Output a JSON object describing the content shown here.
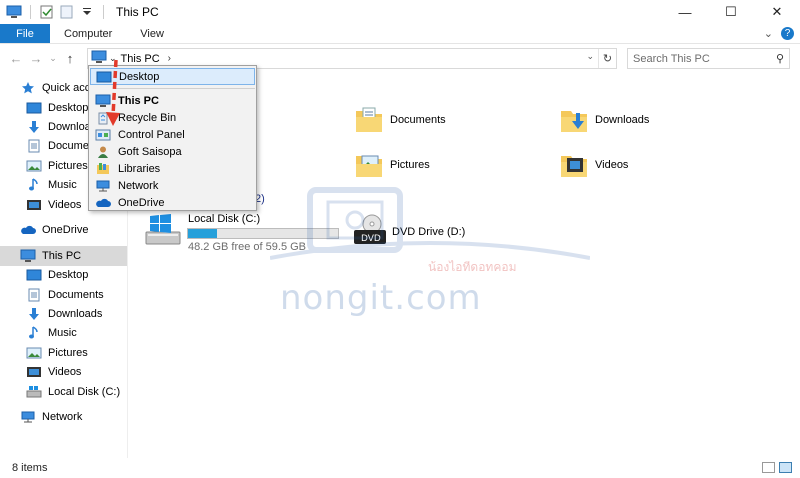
{
  "window": {
    "title": "This PC",
    "minimize": "—",
    "maximize": "☐",
    "close": "✕"
  },
  "ribbon": {
    "file": "File",
    "tabs": [
      "Computer",
      "View"
    ],
    "expand": "⌄",
    "help": "?"
  },
  "nav": {
    "back": "←",
    "forward": "→",
    "recent": "⌄",
    "up": "↑",
    "address_chevron": "⌄",
    "crumb": "This PC",
    "crumb_arrow": "›",
    "address_dropdown": "⌄",
    "refresh": "↻",
    "search_placeholder": "Search This PC",
    "search_icon": "⚲"
  },
  "sidebar": {
    "items": [
      {
        "label": "Quick access",
        "icon": "star-icon"
      },
      {
        "label": "Desktop",
        "icon": "desktop-icon"
      },
      {
        "label": "Downloads",
        "icon": "download-icon"
      },
      {
        "label": "Documents",
        "icon": "documents-icon"
      },
      {
        "label": "Pictures",
        "icon": "pictures-icon"
      },
      {
        "label": "Music",
        "icon": "music-icon"
      },
      {
        "label": "Videos",
        "icon": "videos-icon"
      },
      {
        "label": "OneDrive",
        "icon": "onedrive-icon"
      },
      {
        "label": "This PC",
        "icon": "computer-icon"
      },
      {
        "label": "Desktop",
        "icon": "desktop-icon"
      },
      {
        "label": "Documents",
        "icon": "documents-icon"
      },
      {
        "label": "Downloads",
        "icon": "download-icon"
      },
      {
        "label": "Music",
        "icon": "music-icon"
      },
      {
        "label": "Pictures",
        "icon": "pictures-icon"
      },
      {
        "label": "Videos",
        "icon": "videos-icon"
      },
      {
        "label": "Local Disk (C:)",
        "icon": "drive-icon"
      },
      {
        "label": "Network",
        "icon": "network-icon"
      }
    ]
  },
  "content": {
    "folders": [
      {
        "label": "Documents"
      },
      {
        "label": "Downloads"
      },
      {
        "label": "Pictures"
      },
      {
        "label": "Videos"
      }
    ],
    "devices_header_tail": "2)",
    "drives": [
      {
        "label": "Local Disk (C:)",
        "free": "48.2 GB free of 59.5 GB",
        "used_fraction": 0.19
      },
      {
        "label": "DVD Drive (D:)"
      }
    ]
  },
  "dropdown": {
    "items": [
      {
        "label": "Desktop",
        "icon": "desktop-icon"
      },
      {
        "label": "This PC",
        "icon": "computer-icon"
      },
      {
        "label": "Recycle Bin",
        "icon": "recycle-bin-icon"
      },
      {
        "label": "Control Panel",
        "icon": "control-panel-icon"
      },
      {
        "label": "Goft Saisopa",
        "icon": "user-icon"
      },
      {
        "label": "Libraries",
        "icon": "libraries-icon"
      },
      {
        "label": "Network",
        "icon": "network-icon"
      },
      {
        "label": "OneDrive",
        "icon": "onedrive-icon"
      }
    ]
  },
  "watermark": {
    "brand": "nongit.com",
    "tagline": "น้องไอทีดอทคอม"
  },
  "status": {
    "items": "8 items"
  },
  "colors": {
    "accent": "#1979ca",
    "selection": "#d9d9d9",
    "highlight": "#dcecfc",
    "progress": "#26a0da",
    "annotation": "#e23a2a"
  }
}
